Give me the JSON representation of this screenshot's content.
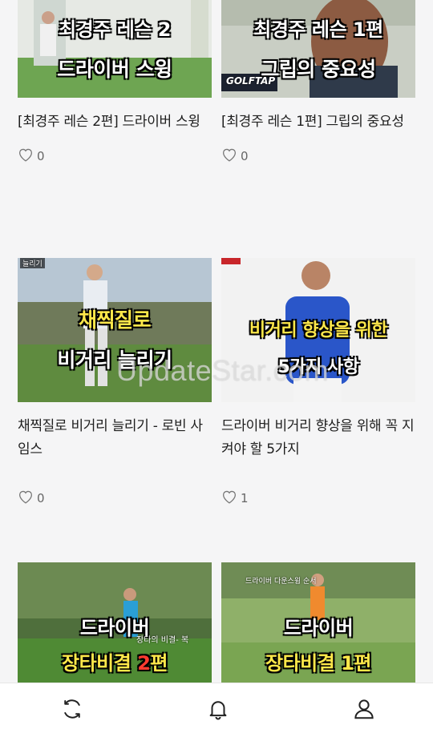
{
  "cards": [
    {
      "thumb_lines": [
        "최경주 레슨 2",
        "드라이버 스윙"
      ],
      "thumb_small": "",
      "title": "[최경주 레슨 2편] 드라이버 스윙",
      "likes": "0"
    },
    {
      "thumb_lines": [
        "최경주 레슨 1편",
        "그립의 중요성"
      ],
      "thumb_small": "GOLFTAP",
      "title": "[최경주 레슨 1편] 그립의 중요성",
      "likes": "0"
    },
    {
      "thumb_lines": [
        "채찍질로",
        "비거리 늘리기"
      ],
      "thumb_small": "늘리기",
      "title": "채찍질로 비거리 늘리기 - 로빈 사임스",
      "likes": "0"
    },
    {
      "thumb_lines": [
        "비거리 향상을 위한",
        "5가지 사항"
      ],
      "thumb_small": "",
      "title": "드라이버 비거리 향상을 위해 꼭 지켜야 할 5가지",
      "likes": "1"
    },
    {
      "thumb_lines": [
        "드라이버",
        "장타비결 ",
        "2",
        "편"
      ],
      "thumb_small": "장타의 비결- 복",
      "title": "",
      "likes": ""
    },
    {
      "thumb_lines": [
        "드라이버",
        "장타비결 1편"
      ],
      "thumb_small": "드라이버 다운스윙 순서",
      "title": "",
      "likes": ""
    }
  ],
  "watermark": "UpdateStar.com",
  "bottom_nav": [
    {
      "icon": "refresh-icon"
    },
    {
      "icon": "bell-icon"
    },
    {
      "icon": "user-icon"
    }
  ]
}
